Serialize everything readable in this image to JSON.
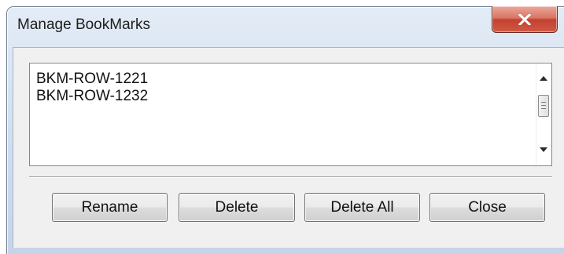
{
  "window": {
    "title": "Manage BookMarks",
    "close_icon": "close-icon"
  },
  "bookmarks": {
    "items": [
      {
        "label": "BKM-ROW-1221"
      },
      {
        "label": "BKM-ROW-1232"
      }
    ]
  },
  "buttons": {
    "rename": "Rename",
    "delete": "Delete",
    "delete_all": "Delete All",
    "close": "Close"
  },
  "colors": {
    "title_bar": "#d3e0f0",
    "close_button": "#c9503c",
    "client_background": "#f0f0f0"
  }
}
